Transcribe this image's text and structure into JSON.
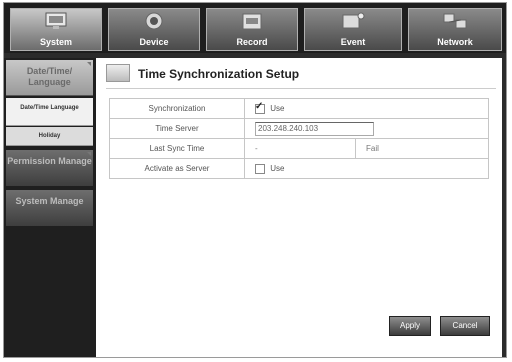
{
  "tabs": [
    {
      "label": "System",
      "icon": "monitor-icon",
      "active": true
    },
    {
      "label": "Device",
      "icon": "camera-icon",
      "active": false
    },
    {
      "label": "Record",
      "icon": "record-icon",
      "active": false
    },
    {
      "label": "Event",
      "icon": "event-icon",
      "active": false
    },
    {
      "label": "Network",
      "icon": "network-icon",
      "active": false
    }
  ],
  "sidebar": {
    "date_time_language": "Date/Time/ Language",
    "sub_date_time_language": "Date/Time Language",
    "sub_holiday": "Holiday",
    "permission_manage": "Permission Manage",
    "system_manage": "System Manage"
  },
  "page": {
    "title": "Time Synchronization Setup"
  },
  "form": {
    "synchronization_label": "Synchronization",
    "synchronization_value": "Use",
    "synchronization_checked": true,
    "time_server_label": "Time Server",
    "time_server_value": "203.248.240.103",
    "last_sync_label": "Last Sync Time",
    "last_sync_value": "-",
    "last_sync_status": "Fail",
    "activate_label": "Activate as Server",
    "activate_value": "Use",
    "activate_checked": false
  },
  "buttons": {
    "apply": "Apply",
    "cancel": "Cancel"
  }
}
